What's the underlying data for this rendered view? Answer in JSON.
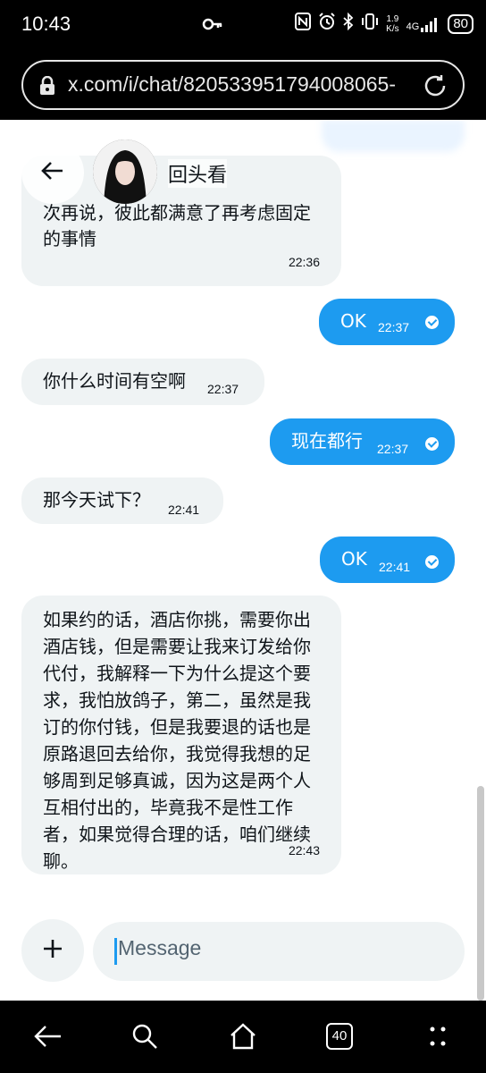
{
  "status_bar": {
    "time": "10:43",
    "net_speed_value": "1.9",
    "net_speed_unit": "K/s",
    "network": "4G",
    "battery": "80"
  },
  "browser": {
    "url": "x.com/i/chat/820533951794008065-"
  },
  "chat": {
    "contact_name": "回头看",
    "messages": [
      {
        "direction": "incoming",
        "text": "...提...，我也比较直接，你什么时候有时间的话，可以先去酒店做一次再说，彼此都满意了再考虑固定的事情",
        "time": "22:36"
      },
      {
        "direction": "outgoing",
        "text": "OK",
        "time": "22:37"
      },
      {
        "direction": "incoming",
        "text": "你什么时间有空啊",
        "time": "22:37"
      },
      {
        "direction": "outgoing",
        "text": "现在都行",
        "time": "22:37"
      },
      {
        "direction": "incoming",
        "text": "那今天试下？",
        "time": "22:41"
      },
      {
        "direction": "outgoing",
        "text": "OK",
        "time": "22:41"
      },
      {
        "direction": "incoming",
        "text": "如果约的话，酒店你挑，需要你出酒店钱，但是需要让我来订发给你代付，我解释一下为什么提这个要求，我怕放鸽子，第二，虽然是我订的你付钱，但是我要退的话也是原路退回去给你，我觉得我想的足够周到足够真诚，因为这是两个人互相付出的，毕竟我不是性工作者，如果觉得合理的话，咱们继续聊。",
        "time": "22:43"
      }
    ],
    "composer_placeholder": "Message"
  },
  "nav": {
    "tabs_count": "40"
  },
  "colors": {
    "accent": "#1d9bf0",
    "incoming_bubble": "#eff3f4"
  }
}
